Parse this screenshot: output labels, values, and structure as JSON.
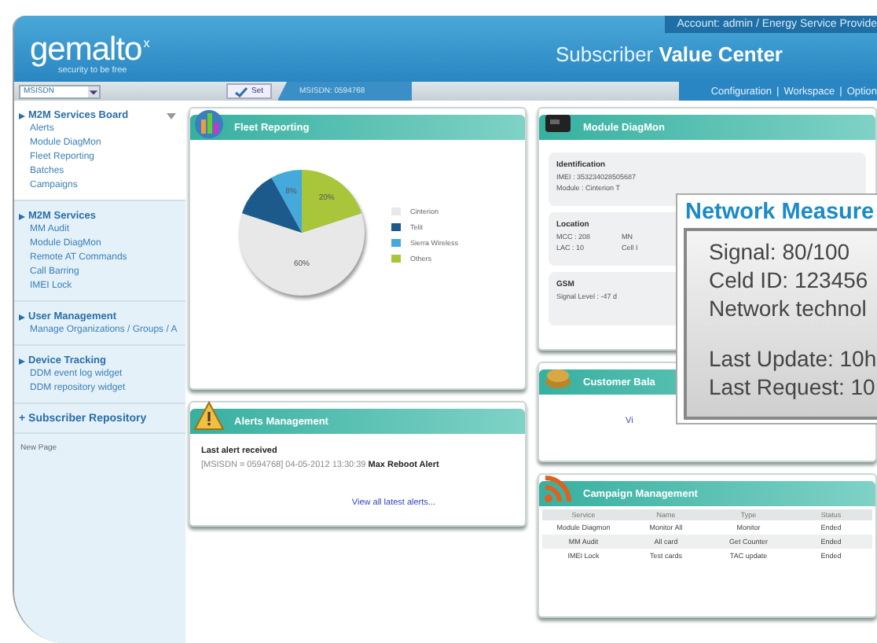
{
  "header": {
    "logo": "gemalto",
    "logo_mark": "x",
    "tagline": "security to be free",
    "account": "Account: admin / Energy Service Provide",
    "title": "Subscriber **Value Center**",
    "links": [
      "Configuration",
      "Workspace",
      "Option"
    ],
    "link_separator": "|"
  },
  "toolbar": {
    "msisdn_field": {
      "value": "MSISDN"
    },
    "set_button": "Set",
    "tab": "MSISDN: 0594768"
  },
  "sidebar": {
    "sections": [
      {
        "kind": "group",
        "title": "M2M Services Board",
        "expanded": true,
        "items": [
          "Alerts",
          "Module DiagMon",
          "Fleet Reporting",
          "Batches",
          "Campaigns"
        ]
      },
      {
        "kind": "group",
        "title": "M2M Services",
        "expanded": false,
        "items": [
          "MM Audit",
          "Module DiagMon",
          "Remote AT Commands",
          "Call Barring",
          "IMEI Lock"
        ]
      },
      {
        "kind": "group",
        "title": "User Management",
        "expanded": false,
        "items": [
          "Manage Organizations / Groups / A"
        ]
      },
      {
        "kind": "group",
        "title": "Device Tracking",
        "expanded": false,
        "items": [
          "DDM event log widget",
          "DDM repository widget"
        ]
      },
      {
        "kind": "link",
        "title": "+ Subscriber Repository"
      }
    ],
    "footer": "New Page"
  },
  "fleet_reporting": {
    "title": "Fleet Reporting",
    "chart_data": {
      "type": "pie",
      "categories": [
        "Cinterion",
        "Telit",
        "Sierra Wireless",
        "Others"
      ],
      "values": [
        60,
        12,
        8,
        20
      ],
      "colors": [
        "#e8e8e8",
        "#1d5a8c",
        "#45a9dc",
        "#a9c63a"
      ],
      "value_labels": [
        "60%",
        null,
        "8%",
        "20%"
      ]
    }
  },
  "alerts": {
    "title": "Alerts Management",
    "heading": "Last alert received",
    "entry": "[MSISDN = 0594768]  04-05-2012 13:30:39  **Max Reboot Alert**",
    "link": "View all latest alerts..."
  },
  "module_diagmon": {
    "title": "Module DiagMon",
    "groups": [
      {
        "title": "Identification",
        "lines": [
          "IMEI : 353234028505687",
          "Module : Cinterion T"
        ]
      },
      {
        "title": "Location",
        "lines": [
          "MCC : 208",
          "LAC : 10"
        ],
        "side": [
          "MN",
          "Cell I"
        ]
      },
      {
        "title": "GSM",
        "lines": [
          "Signal Level : -47 d"
        ]
      }
    ]
  },
  "customer_balance": {
    "title": "Customer Bala",
    "link": "Vi"
  },
  "campaigns": {
    "title": "Campaign Management",
    "columns": [
      "Service",
      "Name",
      "Type",
      "Status"
    ],
    "rows": [
      [
        "Module Diagmon",
        "Monitor All",
        "Monitor",
        "Ended"
      ],
      [
        "MM Audit",
        "All card",
        "Get Counter",
        "Ended"
      ],
      [
        "IMEI Lock",
        "Test cards",
        "TAC update",
        "Ended"
      ]
    ]
  },
  "network_popup": {
    "title": "Network Measure",
    "lines": [
      "Signal: 80/100",
      "Celd ID: 123456",
      "Network technol"
    ],
    "times": [
      "Last Update: 10h",
      "Last Request: 10"
    ]
  }
}
